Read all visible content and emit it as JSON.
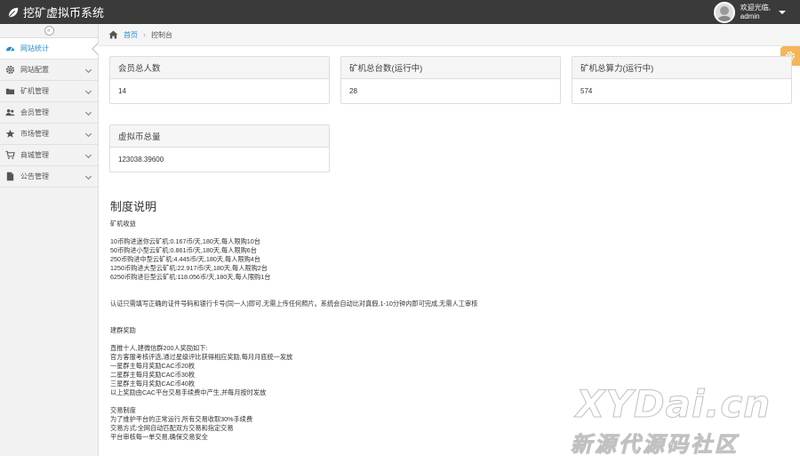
{
  "app": {
    "title": "挖矿虚拟币系统"
  },
  "user": {
    "greeting": "欢迎光临,",
    "name": "admin"
  },
  "sidebar": {
    "collapse_glyph": "«",
    "items": [
      {
        "label": "网站统计",
        "icon": "dashboard-icon",
        "active": true
      },
      {
        "label": "网站配置",
        "icon": "gear-icon"
      },
      {
        "label": "矿机管理",
        "icon": "folder-icon"
      },
      {
        "label": "会员管理",
        "icon": "users-icon"
      },
      {
        "label": "市场管理",
        "icon": "star-icon"
      },
      {
        "label": "商城管理",
        "icon": "cart-icon"
      },
      {
        "label": "公告管理",
        "icon": "file-icon"
      }
    ]
  },
  "breadcrumb": {
    "home": "首页",
    "current": "控制台"
  },
  "stats": [
    {
      "label": "会员总人数",
      "value": "14"
    },
    {
      "label": "矿机总台数(运行中)",
      "value": "28"
    },
    {
      "label": "矿机总算力(运行中)",
      "value": "574"
    },
    {
      "label": "虚拟币总量",
      "value": "123038.39600"
    }
  ],
  "rules": {
    "title": "制度说明",
    "lines": [
      "矿机收益",
      "",
      "10币购进迷你云矿机:0.167币/天,180天,每人限购10台",
      "50币购进小型云矿机:0.861币/天,180天,每人限购6台",
      "250币购进中型云矿机:4.445币/天,180天,每人限购4台",
      "1250币购进大型云矿机:22.917币/天,180天,每人限购2台",
      "6250币购进巨型云矿机:118.056币/天,180天,每人限购1台",
      "",
      "",
      "认证只需填写正确的证件号码和银行卡号(同一人)即可,无需上传任何照片。系统会自动比对真假,1-10分钟内即可完成,无需人工审核",
      "",
      "",
      "建群奖励",
      "",
      "直推十人,建微信群200人奖励如下:",
      "官方客服考核评选,通过星级评比获得相应奖励,每月月底统一发放",
      "一星群主每月奖励CAC币20枚",
      "二星群主每月奖励CAC币30枚",
      "三星群主每月奖励CAC币40枚",
      "以上奖励由CAC平台交易手续费中产生,并每月按时发放",
      "",
      "交易制度",
      "为了维护平台的正常运行,所有交易收取30%手续费",
      "交易方式:全网自动匹配双方交易和指定交易",
      "平台审核每一单交易,确保交易安全"
    ]
  },
  "watermark": {
    "line1": "XYDai.cn",
    "line2": "新源代源码社区"
  },
  "colors": {
    "topbar": "#3a3a3a",
    "accent": "#2a8bcc",
    "settings": "#f5b55a"
  }
}
